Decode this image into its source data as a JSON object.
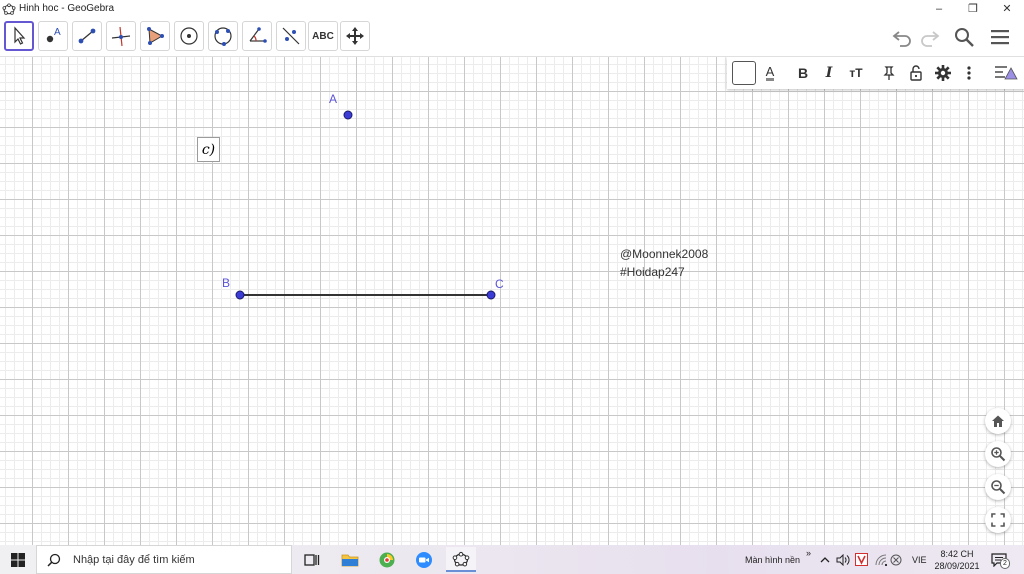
{
  "window": {
    "title": "Hinh hoc - GeoGebra",
    "controls": [
      "minimize",
      "restore",
      "close"
    ]
  },
  "toolbar": {
    "tools": [
      {
        "name": "move-tool",
        "icon": "arrow-cursor-icon",
        "active": true
      },
      {
        "name": "point-tool",
        "icon": "point-icon"
      },
      {
        "name": "segment-tool",
        "icon": "segment-icon"
      },
      {
        "name": "perpendicular-line-tool",
        "icon": "perpendicular-icon"
      },
      {
        "name": "polygon-tool",
        "icon": "polygon-icon"
      },
      {
        "name": "circle-center-point-tool",
        "icon": "circle-center-icon"
      },
      {
        "name": "circle-three-points-tool",
        "icon": "circle-three-points-icon"
      },
      {
        "name": "angle-tool",
        "icon": "angle-icon"
      },
      {
        "name": "reflect-tool",
        "icon": "reflect-icon"
      },
      {
        "name": "text-tool",
        "label": "ABC"
      },
      {
        "name": "move-graphics-view-tool",
        "icon": "move-arrows-icon"
      }
    ],
    "right": [
      "undo-icon",
      "redo-icon",
      "search-icon",
      "menu-icon"
    ]
  },
  "stylebar": {
    "bold": "B",
    "italic": "I",
    "text_color_letter": "A",
    "font_size": "тT"
  },
  "canvas": {
    "text_object": "c)",
    "points": [
      {
        "label": "A"
      },
      {
        "label": "B"
      },
      {
        "label": "C"
      }
    ],
    "segment": "BC",
    "watermark_lines": [
      "@Moonnek2008",
      "#Hoidap247"
    ],
    "point_color": "#3b3bd6",
    "label_color": "#5b55d6"
  },
  "nav_buttons": [
    "home-icon",
    "zoom-in-icon",
    "zoom-out-icon",
    "fullscreen-icon"
  ],
  "taskbar": {
    "search_placeholder": "Nhập tại đây để tìm kiếm",
    "desktop_label": "Màn hình nền",
    "chevron": "»",
    "language": "VIE",
    "time": "8:42 CH",
    "date": "28/09/2021",
    "notification_count": "2"
  }
}
